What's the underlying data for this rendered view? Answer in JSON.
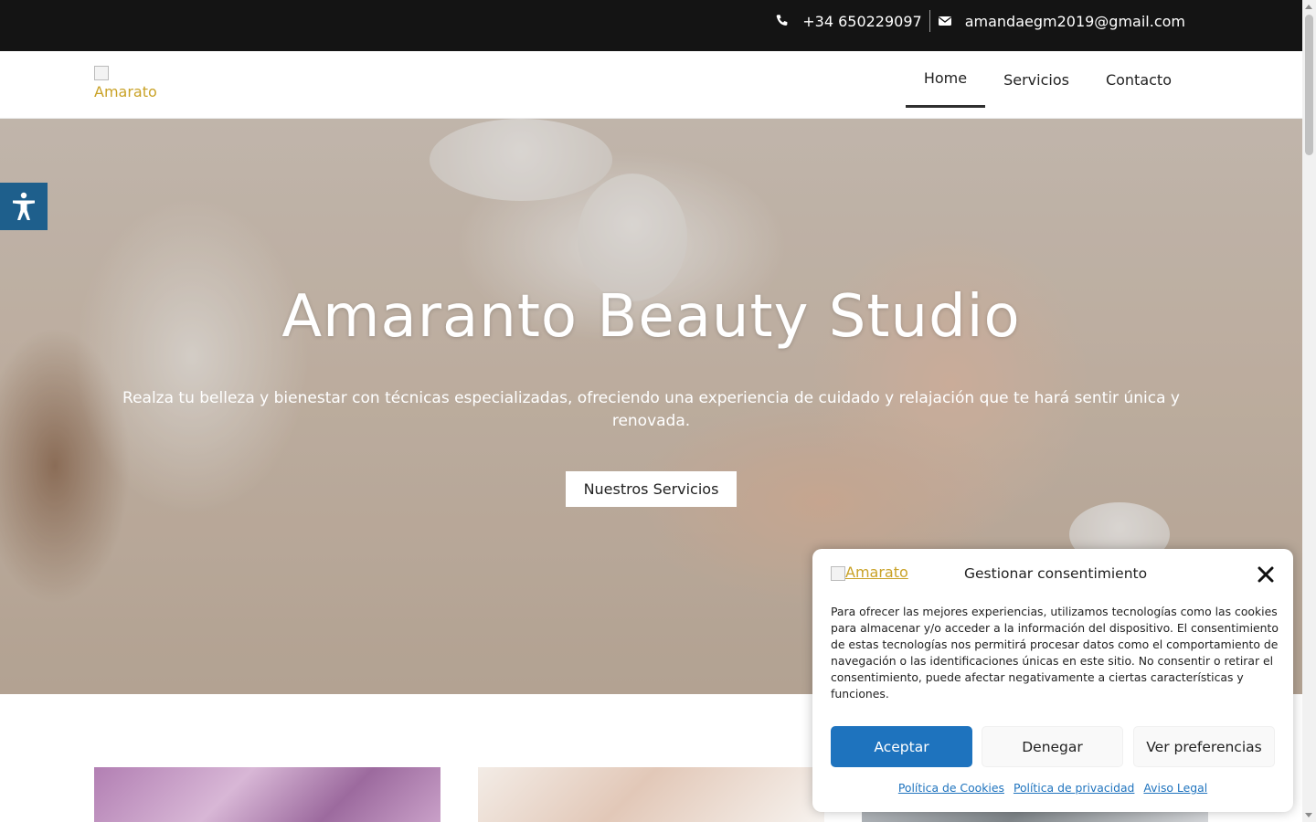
{
  "topbar": {
    "phone": "+34 650229097",
    "email": "amandaegm2019@gmail.com",
    "phone_icon": "phone-icon",
    "email_icon": "envelope-icon"
  },
  "header": {
    "logo_alt": "Amarato",
    "nav": [
      {
        "label": "Home",
        "active": true
      },
      {
        "label": "Servicios",
        "active": false
      },
      {
        "label": "Contacto",
        "active": false
      }
    ]
  },
  "hero": {
    "title": "Amaranto Beauty Studio",
    "subtitle": "Realza tu belleza y bienestar con técnicas especializadas, ofreciendo una experiencia de cuidado y relajación que te hará sentir única y renovada.",
    "cta_label": "Nuestros Servicios"
  },
  "accessibility": {
    "icon": "accessibility-icon"
  },
  "consent": {
    "logo_alt": "Amarato",
    "title": "Gestionar consentimiento",
    "body": "Para ofrecer las mejores experiencias, utilizamos tecnologías como las cookies para almacenar y/o acceder a la información del dispositivo. El consentimiento de estas tecnologías nos permitirá procesar datos como el comportamiento de navegación o las identificaciones únicas en este sitio. No consentir o retirar el consentimiento, puede afectar negativamente a ciertas características y funciones.",
    "accept_label": "Aceptar",
    "deny_label": "Denegar",
    "prefs_label": "Ver preferencias",
    "links": [
      "Política de Cookies",
      "Política de privacidad",
      "Aviso Legal"
    ]
  },
  "colors": {
    "topbar_bg": "#141414",
    "accent_blue": "#1e73be",
    "a11y_bg": "#1e5f8c",
    "logo_text": "#c9a227"
  }
}
